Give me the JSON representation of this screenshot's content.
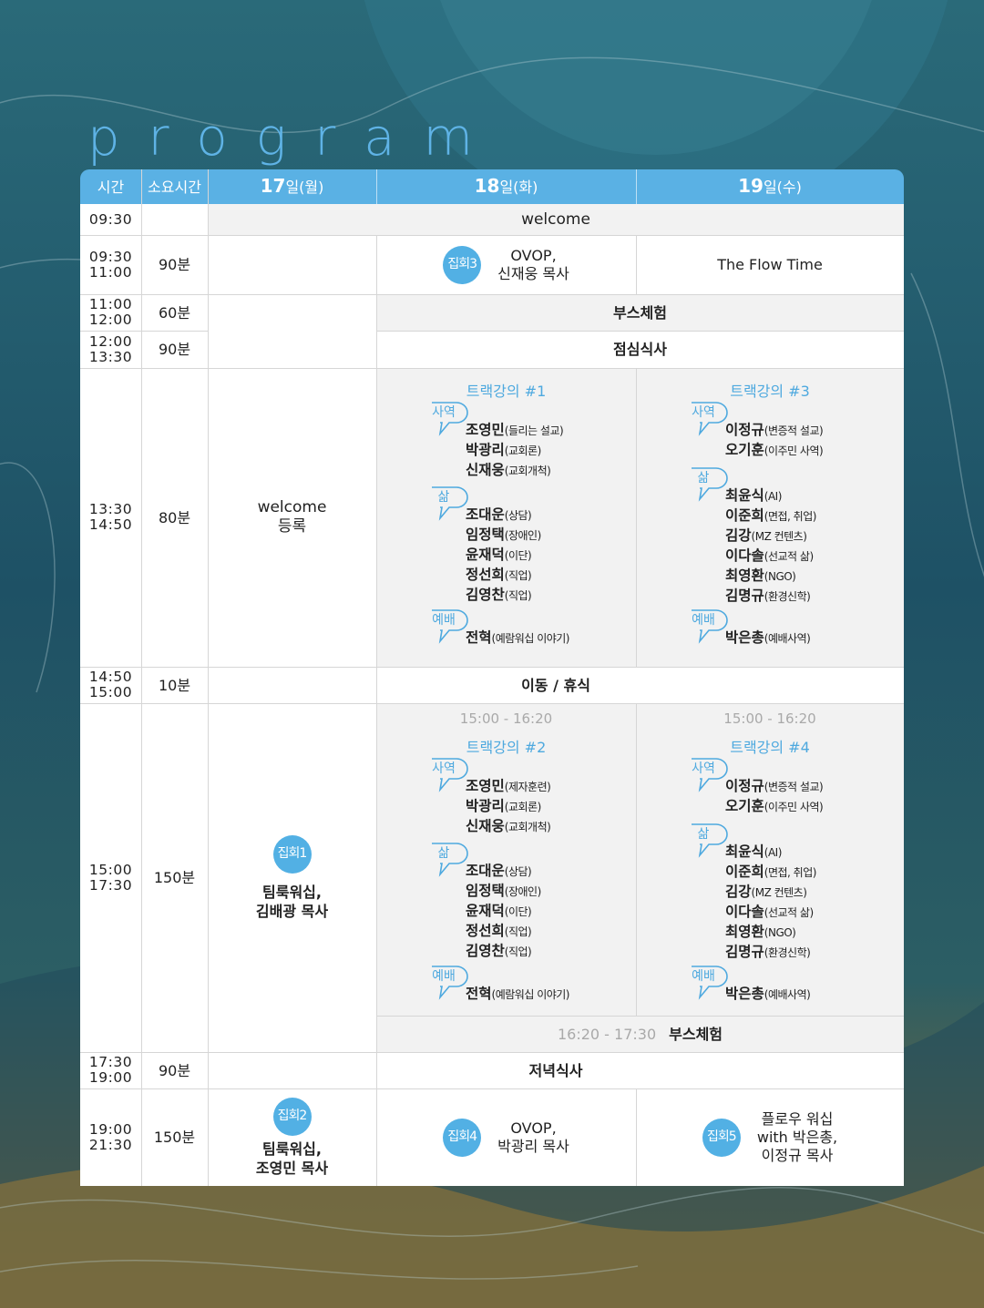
{
  "title": "program",
  "header": {
    "time": "시간",
    "duration": "소요시간",
    "d17": {
      "num": "17",
      "rest": "일(월)"
    },
    "d18": {
      "num": "18",
      "rest": "일(화)"
    },
    "d19": {
      "num": "19",
      "rest": "일(수)"
    }
  },
  "rows": {
    "r1": {
      "time": "09:30",
      "event": "welcome"
    },
    "r2": {
      "start": "09:30",
      "end": "11:00",
      "dur": "90분",
      "d18": {
        "badge": "집회3",
        "line1": "OVOP,",
        "line2": "신재웅 목사"
      },
      "d19": "The Flow Time"
    },
    "r3": {
      "start": "11:00",
      "end": "12:00",
      "dur": "60분",
      "event": "부스체험"
    },
    "r4": {
      "start": "12:00",
      "end": "13:30",
      "dur": "90분",
      "event": "점심식사"
    },
    "r5": {
      "start": "13:30",
      "end": "14:50",
      "dur": "80분",
      "d17_line1": "welcome",
      "d17_line2": "등록"
    },
    "r6": {
      "start": "14:50",
      "end": "15:00",
      "dur": "10분",
      "event": "이동 / 휴식"
    },
    "r7": {
      "start": "15:00",
      "end": "17:30",
      "dur": "150분",
      "d17": {
        "badge": "집회1",
        "line1": "팀룩워십,",
        "line2": "김배광 목사"
      },
      "booth_time": "16:20 - 17:30",
      "booth": "부스체험"
    },
    "r8": {
      "start": "17:30",
      "end": "19:00",
      "dur": "90분",
      "event": "저녁식사"
    },
    "r9": {
      "start": "19:00",
      "end": "21:30",
      "dur": "150분",
      "d17": {
        "badge": "집회2",
        "line1": "팀룩워십,",
        "line2": "조영민 목사"
      },
      "d18": {
        "badge": "집회4",
        "line1": "OVOP,",
        "line2": "박광리 목사"
      },
      "d19": {
        "badge": "집회5",
        "line1": "플로우 워십",
        "line2": "with 박은총,",
        "line3": "이정규 목사"
      }
    }
  },
  "tracks": {
    "t1": {
      "title": "트랙강의 #1",
      "g1": {
        "tag": "사역",
        "people": [
          [
            "조영민",
            "(들리는 설교)"
          ],
          [
            "박광리",
            "(교회론)"
          ],
          [
            "신재웅",
            "(교회개척)"
          ]
        ]
      },
      "g2": {
        "tag": "삶",
        "people": [
          [
            "조대운",
            "(상담)"
          ],
          [
            "임정택",
            "(장애인)"
          ],
          [
            "윤재덕",
            "(이단)"
          ],
          [
            "정선희",
            "(직업)"
          ],
          [
            "김영찬",
            "(직업)"
          ]
        ]
      },
      "g3": {
        "tag": "예배",
        "people": [
          [
            "전혁",
            "(예람워십 이야기)"
          ]
        ]
      }
    },
    "t3": {
      "title": "트랙강의 #3",
      "g1": {
        "tag": "사역",
        "people": [
          [
            "이정규",
            "(변증적 설교)"
          ],
          [
            "오기훈",
            "(이주민 사역)"
          ]
        ]
      },
      "g2": {
        "tag": "삶",
        "people": [
          [
            "최윤식",
            "(AI)"
          ],
          [
            "이준희",
            "(면접, 취업)"
          ],
          [
            "김강",
            "(MZ 컨텐츠)"
          ],
          [
            "이다솔",
            "(선교적 삶)"
          ],
          [
            "최영환",
            "(NGO)"
          ],
          [
            "김명규",
            "(환경신학)"
          ]
        ]
      },
      "g3": {
        "tag": "예배",
        "people": [
          [
            "박은총",
            "(예배사역)"
          ]
        ]
      }
    },
    "t2": {
      "time": "15:00 - 16:20",
      "title": "트랙강의 #2",
      "g1": {
        "tag": "사역",
        "people": [
          [
            "조영민",
            "(제자훈련)"
          ],
          [
            "박광리",
            "(교회론)"
          ],
          [
            "신재웅",
            "(교회개척)"
          ]
        ]
      },
      "g2": {
        "tag": "삶",
        "people": [
          [
            "조대운",
            "(상담)"
          ],
          [
            "임정택",
            "(장애인)"
          ],
          [
            "윤재덕",
            "(이단)"
          ],
          [
            "정선희",
            "(직업)"
          ],
          [
            "김영찬",
            "(직업)"
          ]
        ]
      },
      "g3": {
        "tag": "예배",
        "people": [
          [
            "전혁",
            "(예람워십 이야기)"
          ]
        ]
      }
    },
    "t4": {
      "time": "15:00 - 16:20",
      "title": "트랙강의 #4",
      "g1": {
        "tag": "사역",
        "people": [
          [
            "이정규",
            "(변증적 설교)"
          ],
          [
            "오기훈",
            "(이주민 사역)"
          ]
        ]
      },
      "g2": {
        "tag": "삶",
        "people": [
          [
            "최윤식",
            "(AI)"
          ],
          [
            "이준희",
            "(면접, 취업)"
          ],
          [
            "김강",
            "(MZ 컨텐츠)"
          ],
          [
            "이다솔",
            "(선교적 삶)"
          ],
          [
            "최영환",
            "(NGO)"
          ],
          [
            "김명규",
            "(환경신학)"
          ]
        ]
      },
      "g3": {
        "tag": "예배",
        "people": [
          [
            "박은총",
            "(예배사역)"
          ]
        ]
      }
    }
  },
  "colors": {
    "accent": "#5ab1e4",
    "bubble": "#4ea9df",
    "teal": "#1d4f62",
    "sand": "#8a6a2e"
  }
}
